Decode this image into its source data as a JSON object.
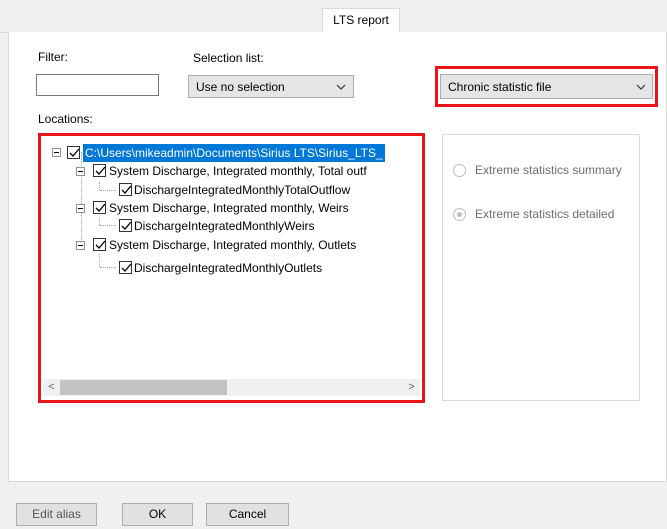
{
  "tabs": [
    {
      "label": "LTS report"
    }
  ],
  "filter": {
    "label": "Filter:",
    "value": ""
  },
  "selection_list": {
    "label": "Selection list:",
    "selected": "Use no selection"
  },
  "file_type": {
    "selected": "Chronic statistic file"
  },
  "locations": {
    "label": "Locations:",
    "root": "C:\\Users\\mikeadmin\\Documents\\Sirius LTS\\Sirius_LTS_",
    "groups": [
      {
        "label": "System Discharge, Integrated monthly, Total outf",
        "child": "DischargeIntegratedMonthlyTotalOutflow"
      },
      {
        "label": "System Discharge, Integrated monthly, Weirs",
        "child": "DischargeIntegratedMonthlyWeirs"
      },
      {
        "label": "System Discharge, Integrated monthly, Outlets",
        "child": "DischargeIntegratedMonthlyOutlets"
      }
    ]
  },
  "options": {
    "summary": "Extreme statistics summary",
    "detailed": "Extreme statistics detailed",
    "selected": "detailed"
  },
  "buttons": {
    "edit_alias": "Edit alias",
    "ok": "OK",
    "cancel": "Cancel"
  },
  "colors": {
    "highlight": "#e8141c",
    "selection": "#0078d7"
  }
}
